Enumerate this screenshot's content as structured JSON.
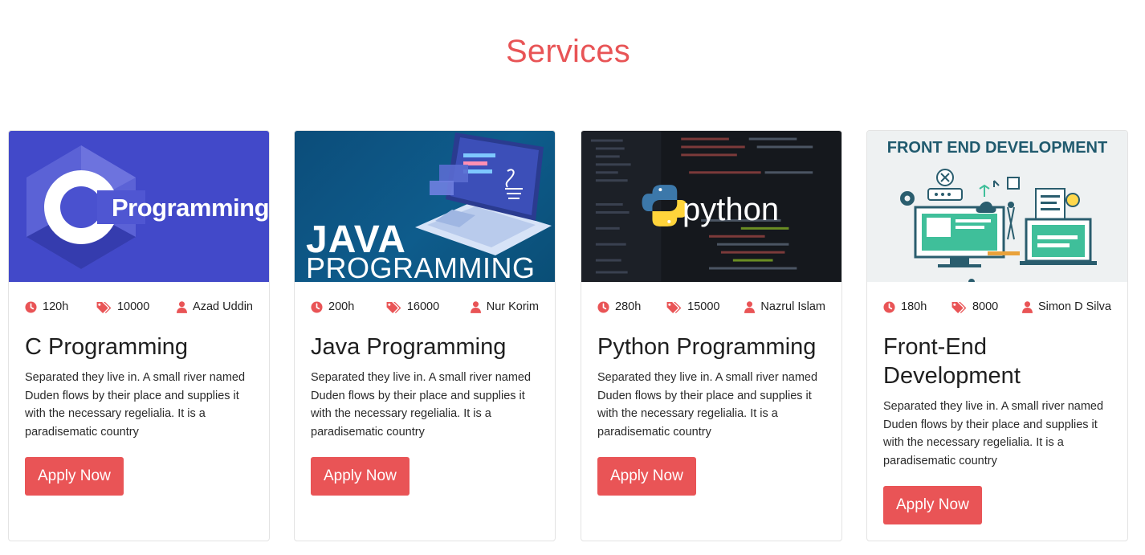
{
  "section": {
    "title": "Services"
  },
  "colors": {
    "accent": "#e95456",
    "title": "#e85456"
  },
  "meta_icons": {
    "duration": "clock-icon",
    "price": "tags-icon",
    "instructor": "user-icon"
  },
  "cards": [
    {
      "image_text": {
        "title": "Programming"
      },
      "duration": "120h",
      "price": "10000",
      "instructor": "Azad Uddin",
      "title": "C Programming",
      "description": "Separated they live in. A small river named Duden flows by their place and supplies it with the necessary regelialia. It is a paradisematic country",
      "button": "Apply Now"
    },
    {
      "image_text": {
        "title": "JAVA",
        "subtitle": "PROGRAMMING"
      },
      "duration": "200h",
      "price": "16000",
      "instructor": "Nur Korim",
      "title": "Java Programming",
      "description": "Separated they live in. A small river named Duden flows by their place and supplies it with the necessary regelialia. It is a paradisematic country",
      "button": "Apply Now"
    },
    {
      "image_text": {
        "title": "python"
      },
      "duration": "280h",
      "price": "15000",
      "instructor": "Nazrul Islam",
      "title": "Python Programming",
      "description": "Separated they live in. A small river named Duden flows by their place and supplies it with the necessary regelialia. It is a paradisematic country",
      "button": "Apply Now"
    },
    {
      "image_text": {
        "title": "FRONT END DEVELOPMENT"
      },
      "duration": "180h",
      "price": "8000",
      "instructor": "Simon D Silva",
      "title": "Front-End Development",
      "description": "Separated they live in. A small river named Duden flows by their place and supplies it with the necessary regelialia. It is a paradisematic country",
      "button": "Apply Now"
    }
  ]
}
